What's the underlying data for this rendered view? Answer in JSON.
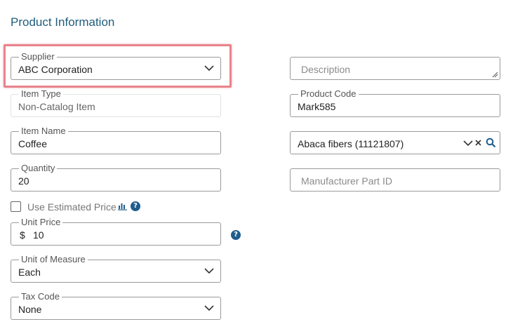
{
  "section": {
    "title": "Product Information"
  },
  "supplier": {
    "label": "Supplier",
    "value": "ABC Corporation"
  },
  "item_type": {
    "label": "Item Type",
    "value": "Non-Catalog Item"
  },
  "item_name": {
    "label": "Item Name",
    "value": "Coffee"
  },
  "quantity": {
    "label": "Quantity",
    "value": "20"
  },
  "estimated_price": {
    "label": "Use Estimated Price",
    "checked": false
  },
  "unit_price": {
    "label": "Unit Price",
    "currency": "$",
    "value": "10"
  },
  "unit_of_measure": {
    "label": "Unit of Measure",
    "value": "Each"
  },
  "tax_code": {
    "label": "Tax Code",
    "value": "None"
  },
  "description": {
    "placeholder": "Description"
  },
  "product_code": {
    "label": "Product Code",
    "value": "Mark585"
  },
  "commodity": {
    "value": "Abaca fibers (11121807)"
  },
  "manufacturer_part": {
    "placeholder": "Manufacturer Part ID"
  },
  "colors": {
    "accent": "#1f5d7c",
    "highlight": "#e8838b",
    "icon": "#1f5d8c"
  },
  "icons": [
    "chevron-down-icon",
    "clear-icon",
    "search-icon",
    "chart-icon",
    "help-icon",
    "resize-icon"
  ]
}
